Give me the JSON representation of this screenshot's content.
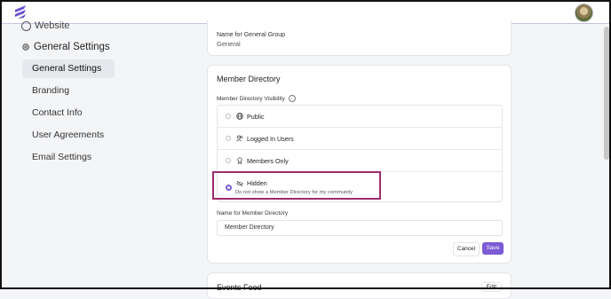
{
  "topbar": {
    "logo_icon": "app-logo-icon",
    "avatar_icon": "user-avatar"
  },
  "sidebar": {
    "website_label": "Website",
    "group_label": "General Settings",
    "items": [
      {
        "label": "General Settings",
        "active": true
      },
      {
        "label": "Branding"
      },
      {
        "label": "Contact Info"
      },
      {
        "label": "User Agreements"
      },
      {
        "label": "Email Settings"
      }
    ]
  },
  "group_card": {
    "label": "Name for General Group",
    "value": "General"
  },
  "member_directory": {
    "title": "Member Directory",
    "visibility_label": "Member Directory Visibility",
    "options": [
      {
        "label": "Public",
        "icon": "globe-icon",
        "selected": false
      },
      {
        "label": "Logged In Users",
        "icon": "users-icon",
        "selected": false
      },
      {
        "label": "Members Only",
        "icon": "badge-icon",
        "selected": false
      },
      {
        "label": "Hidden",
        "icon": "eye-off-icon",
        "selected": true,
        "description": "Do not show a Member Directory for my community"
      }
    ],
    "name_label": "Name for Member Directory",
    "name_value": "Member Directory",
    "cancel_label": "Cancel",
    "save_label": "Save"
  },
  "events_feed": {
    "title": "Events Feed",
    "edit_label": "Edit"
  },
  "colors": {
    "accent": "#7b5cd6",
    "highlight": "#9b2c6a"
  }
}
